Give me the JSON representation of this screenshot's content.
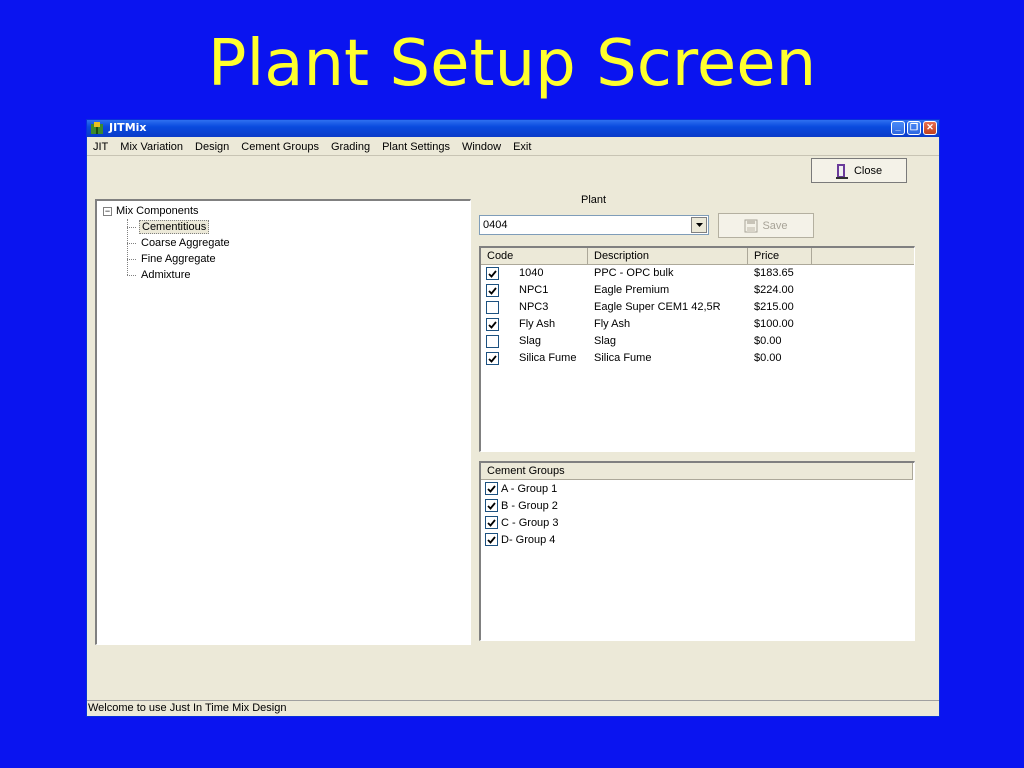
{
  "slide": {
    "title": "Plant Setup Screen"
  },
  "window": {
    "title": "JITMix",
    "controls": [
      "minimize-icon",
      "restore-icon",
      "close-icon"
    ]
  },
  "menu": [
    "JIT",
    "Mix Variation",
    "Design",
    "Cement Groups",
    "Grading",
    "Plant Settings",
    "Window",
    "Exit"
  ],
  "toolbar": {
    "close_label": "Close",
    "save_label": "Save"
  },
  "tree": {
    "root": "Mix Components",
    "expander": "−",
    "children": [
      {
        "label": "Cementitious",
        "selected": true
      },
      {
        "label": "Coarse Aggregate",
        "selected": false
      },
      {
        "label": "Fine Aggregate",
        "selected": false
      },
      {
        "label": "Admixture",
        "selected": false
      }
    ]
  },
  "plant": {
    "label": "Plant",
    "value": "0404"
  },
  "grid": {
    "columns": [
      "Code",
      "Description",
      "Price"
    ],
    "rows": [
      {
        "checked": true,
        "code": "1040",
        "description": "PPC - OPC bulk",
        "price": "$183.65"
      },
      {
        "checked": true,
        "code": "NPC1",
        "description": "Eagle Premium",
        "price": "$224.00"
      },
      {
        "checked": false,
        "code": "NPC3",
        "description": "Eagle Super CEM1 42,5R",
        "price": "$215.00"
      },
      {
        "checked": true,
        "code": "Fly Ash",
        "description": "Fly Ash",
        "price": "$100.00"
      },
      {
        "checked": false,
        "code": "Slag",
        "description": "Slag",
        "price": "$0.00"
      },
      {
        "checked": true,
        "code": "Silica Fume",
        "description": "Silica Fume",
        "price": "$0.00"
      }
    ]
  },
  "cement_groups": {
    "header": "Cement Groups",
    "items": [
      {
        "checked": true,
        "label": "A - Group 1"
      },
      {
        "checked": true,
        "label": "B - Group 2"
      },
      {
        "checked": true,
        "label": "C - Group 3"
      },
      {
        "checked": true,
        "label": "D- Group 4"
      }
    ]
  },
  "status": {
    "text": "Welcome to use Just In Time Mix Design"
  },
  "colors": {
    "slide_bg": "#0A14F0",
    "title": "#FFFF2E",
    "window_bg": "#ECE9D8",
    "titlebar": "#0A4ADE"
  }
}
